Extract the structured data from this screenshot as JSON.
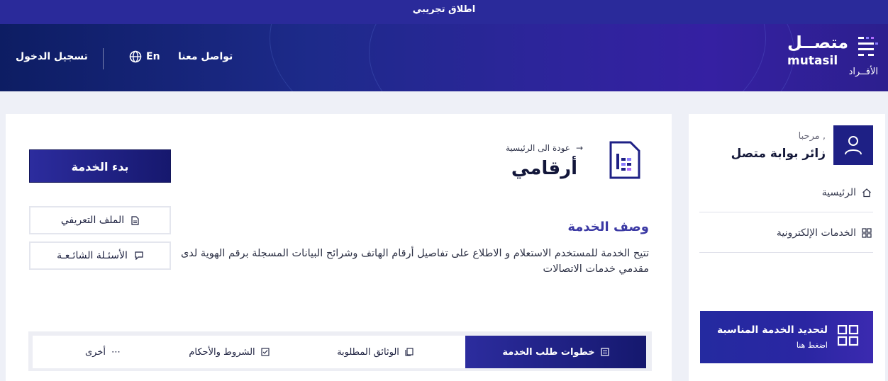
{
  "topbar": {
    "text": "اطلاق تجريبي"
  },
  "header": {
    "login": "تسجيل الدخول",
    "language": "En",
    "contact": "تواصل معنا",
    "logo_ar": "متصــل",
    "logo_en": "mutasil",
    "logo_sub": "الأفــراد"
  },
  "sidebar": {
    "greeting": "مرحبا ,",
    "username": "زائر بوابة متصل",
    "items": [
      {
        "label": "الرئيسية",
        "icon": "home-icon"
      },
      {
        "label": "الخدمات الإلكترونية",
        "icon": "grid-icon"
      }
    ],
    "promo": {
      "title": "لتحديد الخدمة المناسبة",
      "cta": "اضغط هنا"
    }
  },
  "main": {
    "back": "عودة الى الرئيسية",
    "title": "أرقامي",
    "start_button": "بدء الخدمة",
    "profile_button": "الملف التعريفي",
    "faq_button": "الأسئـلة الشائـعـة",
    "desc_title": "وصف الخدمة",
    "desc_text": "تتيح الخدمة للمستخدم الاستعلام و الاطلاع على تفاصيل أرقام الهاتف وشرائح البيانات المسجلة برقم الهوية لدى مقدمي خدمات الاتصالات",
    "tabs": [
      {
        "label": "خطوات طلب الخدمة",
        "active": true
      },
      {
        "label": "الوثائق المطلوبة",
        "active": false
      },
      {
        "label": "الشروط والأحكام",
        "active": false
      },
      {
        "label": "أخرى",
        "active": false
      }
    ]
  },
  "colors": {
    "primary": "#1e2085",
    "accent": "#3b39a4",
    "background": "#eef0f7"
  }
}
